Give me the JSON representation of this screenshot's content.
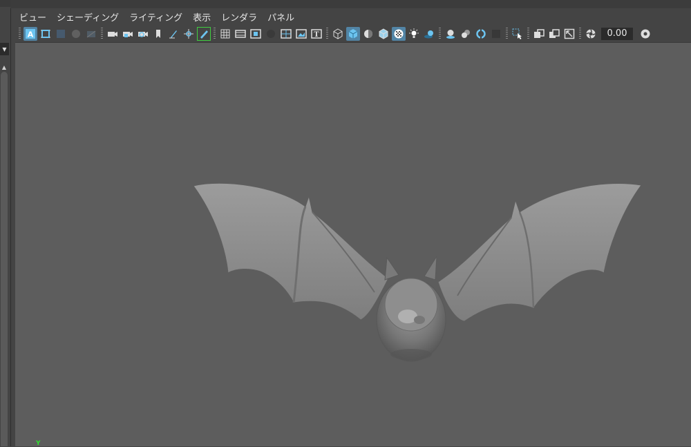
{
  "menubar": {
    "items": [
      "ビュー",
      "シェーディング",
      "ライティング",
      "表示",
      "レンダラ",
      "パネル"
    ]
  },
  "toolbar": {
    "field_value": "0.00"
  },
  "viewport": {
    "axis_label": "Y",
    "model": "bat-mesh"
  },
  "icons": [
    "select-camera-icon",
    "camera-attributes-icon",
    "bookmark-icon",
    "grease-pencil-icon",
    "grid-icon",
    "film-gate-icon",
    "resolution-gate-icon",
    "safe-action-icon",
    "wireframe-icon",
    "smooth-shade-icon",
    "use-default-material-icon",
    "textured-icon",
    "lights-icon",
    "shadows-icon",
    "isolate-select-icon",
    "xray-icon",
    "exposure-icon"
  ],
  "colors": {
    "accent": "#5285a6",
    "menu_bg": "#444444",
    "viewport_bg": "#5d5d5d",
    "axis_y": "#2fe02f"
  }
}
